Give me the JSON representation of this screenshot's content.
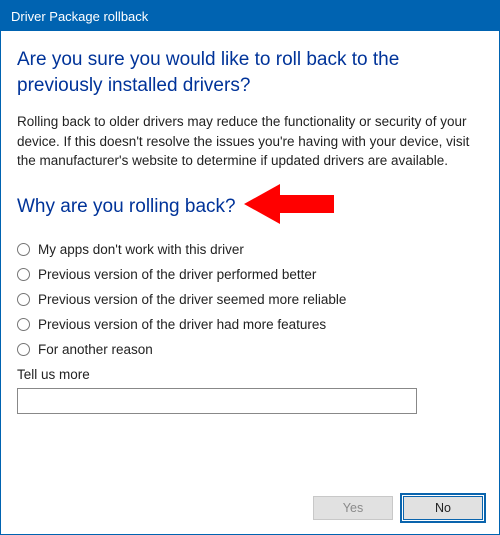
{
  "window": {
    "title": "Driver Package rollback"
  },
  "heading": "Are you sure you would like to roll back to the previously installed drivers?",
  "body": "Rolling back to older drivers may reduce the functionality or security of your device.  If this doesn't resolve the issues you're having with your device, visit the manufacturer's website to determine if updated drivers are available.",
  "why_heading": "Why are you rolling back?",
  "annotation": {
    "arrow_color": "#ff0000"
  },
  "options": [
    {
      "label": "My apps don't work with this driver"
    },
    {
      "label": "Previous version of the driver performed better"
    },
    {
      "label": "Previous version of the driver seemed more reliable"
    },
    {
      "label": "Previous version of the driver had more features"
    },
    {
      "label": "For another reason"
    }
  ],
  "tell_us_more": {
    "label": "Tell us more",
    "value": ""
  },
  "buttons": {
    "yes": "Yes",
    "no": "No"
  }
}
